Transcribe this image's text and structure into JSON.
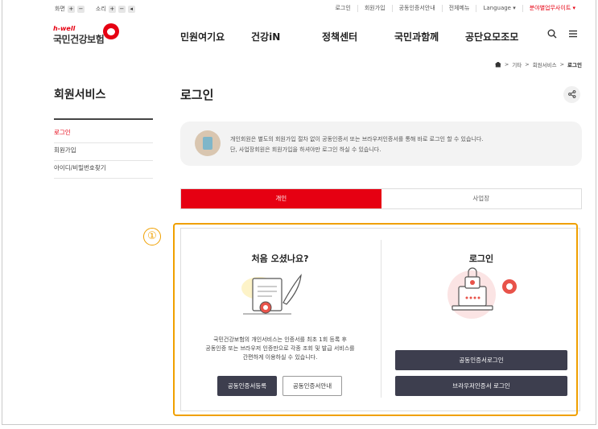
{
  "utility": {
    "screen_label": "화면",
    "sound_label": "소리",
    "links": [
      "로그인",
      "회원가입",
      "공동인증서안내",
      "전체메뉴",
      "Language ▾",
      "분야별업무사이트 ▾"
    ]
  },
  "logo": {
    "small": "h-well",
    "name": "국민건강보험"
  },
  "gnb": [
    "민원여기요",
    "건강iN",
    "정책센터",
    "국민과함께",
    "공단요모조모"
  ],
  "breadcrumb": [
    "기타",
    "회원서비스",
    "로그인"
  ],
  "sidebar": {
    "title": "회원서비스",
    "items": [
      {
        "label": "로그인",
        "active": true
      },
      {
        "label": "회원가입",
        "active": false
      },
      {
        "label": "아이디/비밀번호찾기",
        "active": false
      }
    ]
  },
  "page": {
    "title": "로그인",
    "notice": [
      "개인회원은 별도의 회원가입 절차 없이 공동인증서 또는 브라우저인증서를 통해 바로 로그인 할 수 있습니다.",
      "단, 사업장회원은 회원가입을 하셔야만 로그인 하실 수 있습니다."
    ],
    "tabs": [
      {
        "label": "개인",
        "active": true
      },
      {
        "label": "사업장",
        "active": false
      }
    ],
    "callout_number": "①"
  },
  "first_visit": {
    "heading": "처음 오셨나요?",
    "desc": [
      "국민건강보험의 개인서비스는 인증서를 최초 1회 등록 후",
      "공동인증 또는 브라우저 인증만으로 각종 조회 및 발급 서비스를",
      "간편하게 이용하실 수 있습니다."
    ],
    "register_button": "공동인증서등록",
    "guide_button": "공동인증서안내"
  },
  "login_panel": {
    "heading": "로그인",
    "cert_login_button": "공동인증서로그인",
    "browser_login_button": "브라우저인증서 로그인"
  },
  "colors": {
    "accent": "#e60012",
    "highlight": "#f0a000",
    "dark_button": "#3d3e4e"
  }
}
